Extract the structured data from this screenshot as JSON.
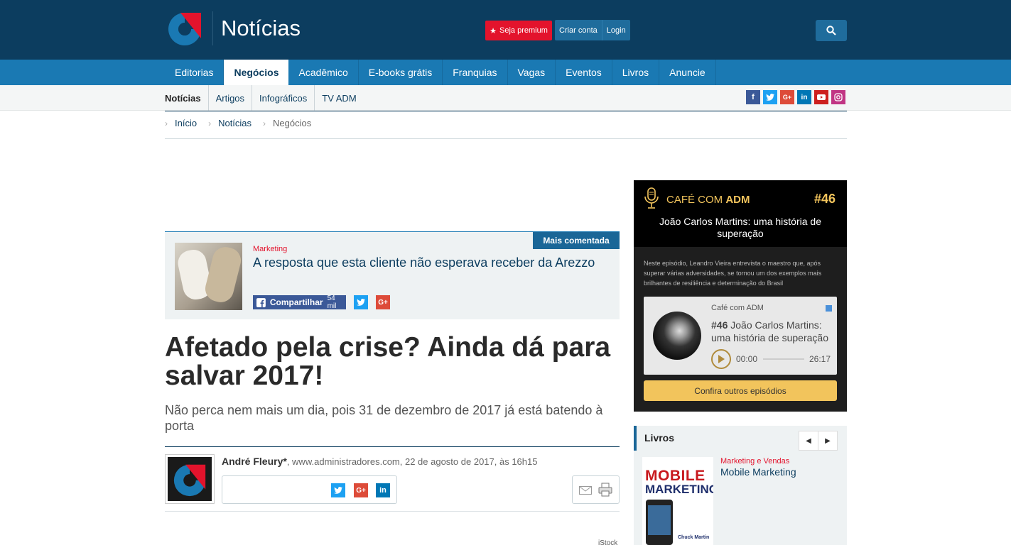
{
  "header": {
    "site_title": "Notícias",
    "premium_label": "Seja premium",
    "create_account_label": "Criar conta",
    "login_label": "Login"
  },
  "main_nav": [
    "Editorias",
    "Negócios",
    "Acadêmico",
    "E-books grátis",
    "Franquias",
    "Vagas",
    "Eventos",
    "Livros",
    "Anuncie"
  ],
  "main_nav_active": "Negócios",
  "sub_nav": [
    "Notícias",
    "Artigos",
    "Infográficos",
    "TV ADM"
  ],
  "social_icons": [
    "facebook-icon",
    "twitter-icon",
    "google-plus-icon",
    "linkedin-icon",
    "youtube-icon",
    "instagram-icon"
  ],
  "breadcrumb": [
    "Início",
    "Notícias",
    "Negócios"
  ],
  "featured": {
    "tag": "Mais comentada",
    "category": "Marketing",
    "title": "A resposta que esta cliente não esperava receber da Arezzo",
    "share_label": "Compartilhar",
    "share_count": "54 mil"
  },
  "article": {
    "title": "Afetado pela crise? Ainda dá para salvar 2017!",
    "subtitle": "Não perca nem mais um dia, pois 31 de dezembro de 2017 já está batendo à porta",
    "author": "André Fleury*",
    "byline_rest": ", www.administradores.com, 22 de agosto de 2017, às 16h15",
    "image_credit": "iStock"
  },
  "podcast": {
    "label_prefix": "CAFÉ COM",
    "label_bold": "ADM",
    "number": "#46",
    "episode_title": "João Carlos Martins: uma história de superação",
    "description": "Neste episódio, Leandro Vieira entrevista o maestro que, após superar várias adversidades, se tornou um dos exemplos mais brilhantes de resiliência e determinação do Brasil",
    "player_show": "Café com ADM",
    "player_number": "#46",
    "player_title": "João Carlos Martins: uma história de superação",
    "time_current": "00:00",
    "time_total": "26:17",
    "progress": 0,
    "button_label": "Confira outros episódios"
  },
  "books": {
    "title": "Livros",
    "cover_line1": "MOBILE",
    "cover_line2": "MARKETING",
    "cover_author": "Chuck Martin",
    "category": "Marketing e Vendas",
    "name": "Mobile Marketing"
  },
  "colors": {
    "header_bg": "#0c3d5f",
    "nav_bg": "#1a79b3",
    "premium_red": "#e3132c",
    "podcast_gold": "#f2c45c"
  }
}
